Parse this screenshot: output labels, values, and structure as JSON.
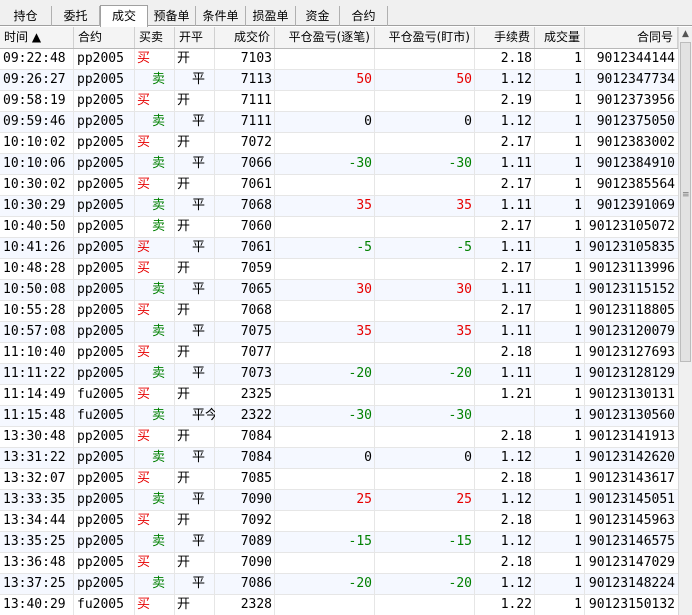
{
  "tabs": [
    {
      "label": "持仓",
      "active": false
    },
    {
      "label": "委托",
      "active": false
    },
    {
      "label": "成交",
      "active": true
    },
    {
      "label": "预备单",
      "active": false
    },
    {
      "label": "条件单",
      "active": false
    },
    {
      "label": "损盈单",
      "active": false
    },
    {
      "label": "资金",
      "active": false
    },
    {
      "label": "合约",
      "active": false
    }
  ],
  "columns": [
    "时间 ▲",
    "合约",
    "买卖",
    "开平",
    "成交价",
    "平仓盈亏(逐笔)",
    "平仓盈亏(盯市)",
    "手续费",
    "成交量",
    "合同号"
  ],
  "colors": {
    "buy": "#e60000",
    "sell": "#008000",
    "profit": "#e60000",
    "loss": "#008000"
  },
  "rows": [
    {
      "time": "09:22:48",
      "contract": "pp2005",
      "side": "买",
      "offset": "开",
      "price": "7103",
      "pnl_trade": "",
      "pnl_mark": "",
      "fee": "2.18",
      "qty": "1",
      "order_no": "9012344144"
    },
    {
      "time": "09:26:27",
      "contract": "pp2005",
      "side": "卖",
      "offset": "平",
      "price": "7113",
      "pnl_trade": "50",
      "pnl_mark": "50",
      "fee": "1.12",
      "qty": "1",
      "order_no": "9012347734"
    },
    {
      "time": "09:58:19",
      "contract": "pp2005",
      "side": "买",
      "offset": "开",
      "price": "7111",
      "pnl_trade": "",
      "pnl_mark": "",
      "fee": "2.19",
      "qty": "1",
      "order_no": "9012373956"
    },
    {
      "time": "09:59:46",
      "contract": "pp2005",
      "side": "卖",
      "offset": "平",
      "price": "7111",
      "pnl_trade": "0",
      "pnl_mark": "0",
      "fee": "1.12",
      "qty": "1",
      "order_no": "9012375050"
    },
    {
      "time": "10:10:02",
      "contract": "pp2005",
      "side": "买",
      "offset": "开",
      "price": "7072",
      "pnl_trade": "",
      "pnl_mark": "",
      "fee": "2.17",
      "qty": "1",
      "order_no": "9012383002"
    },
    {
      "time": "10:10:06",
      "contract": "pp2005",
      "side": "卖",
      "offset": "平",
      "price": "7066",
      "pnl_trade": "-30",
      "pnl_mark": "-30",
      "fee": "1.11",
      "qty": "1",
      "order_no": "9012384910"
    },
    {
      "time": "10:30:02",
      "contract": "pp2005",
      "side": "买",
      "offset": "开",
      "price": "7061",
      "pnl_trade": "",
      "pnl_mark": "",
      "fee": "2.17",
      "qty": "1",
      "order_no": "9012385564"
    },
    {
      "time": "10:30:29",
      "contract": "pp2005",
      "side": "卖",
      "offset": "平",
      "price": "7068",
      "pnl_trade": "35",
      "pnl_mark": "35",
      "fee": "1.11",
      "qty": "1",
      "order_no": "9012391069"
    },
    {
      "time": "10:40:50",
      "contract": "pp2005",
      "side": "卖",
      "offset": "开",
      "price": "7060",
      "pnl_trade": "",
      "pnl_mark": "",
      "fee": "2.17",
      "qty": "1",
      "order_no": "90123105072"
    },
    {
      "time": "10:41:26",
      "contract": "pp2005",
      "side": "买",
      "offset": "平",
      "price": "7061",
      "pnl_trade": "-5",
      "pnl_mark": "-5",
      "fee": "1.11",
      "qty": "1",
      "order_no": "90123105835"
    },
    {
      "time": "10:48:28",
      "contract": "pp2005",
      "side": "买",
      "offset": "开",
      "price": "7059",
      "pnl_trade": "",
      "pnl_mark": "",
      "fee": "2.17",
      "qty": "1",
      "order_no": "90123113996"
    },
    {
      "time": "10:50:08",
      "contract": "pp2005",
      "side": "卖",
      "offset": "平",
      "price": "7065",
      "pnl_trade": "30",
      "pnl_mark": "30",
      "fee": "1.11",
      "qty": "1",
      "order_no": "90123115152"
    },
    {
      "time": "10:55:28",
      "contract": "pp2005",
      "side": "买",
      "offset": "开",
      "price": "7068",
      "pnl_trade": "",
      "pnl_mark": "",
      "fee": "2.17",
      "qty": "1",
      "order_no": "90123118805"
    },
    {
      "time": "10:57:08",
      "contract": "pp2005",
      "side": "卖",
      "offset": "平",
      "price": "7075",
      "pnl_trade": "35",
      "pnl_mark": "35",
      "fee": "1.11",
      "qty": "1",
      "order_no": "90123120079"
    },
    {
      "time": "11:10:40",
      "contract": "pp2005",
      "side": "买",
      "offset": "开",
      "price": "7077",
      "pnl_trade": "",
      "pnl_mark": "",
      "fee": "2.18",
      "qty": "1",
      "order_no": "90123127693"
    },
    {
      "time": "11:11:22",
      "contract": "pp2005",
      "side": "卖",
      "offset": "平",
      "price": "7073",
      "pnl_trade": "-20",
      "pnl_mark": "-20",
      "fee": "1.11",
      "qty": "1",
      "order_no": "90123128129"
    },
    {
      "time": "11:14:49",
      "contract": "fu2005",
      "side": "买",
      "offset": "开",
      "price": "2325",
      "pnl_trade": "",
      "pnl_mark": "",
      "fee": "1.21",
      "qty": "1",
      "order_no": "90123130131"
    },
    {
      "time": "11:15:48",
      "contract": "fu2005",
      "side": "卖",
      "offset": "平今",
      "price": "2322",
      "pnl_trade": "-30",
      "pnl_mark": "-30",
      "fee": "",
      "qty": "1",
      "order_no": "90123130560"
    },
    {
      "time": "13:30:48",
      "contract": "pp2005",
      "side": "买",
      "offset": "开",
      "price": "7084",
      "pnl_trade": "",
      "pnl_mark": "",
      "fee": "2.18",
      "qty": "1",
      "order_no": "90123141913"
    },
    {
      "time": "13:31:22",
      "contract": "pp2005",
      "side": "卖",
      "offset": "平",
      "price": "7084",
      "pnl_trade": "0",
      "pnl_mark": "0",
      "fee": "1.12",
      "qty": "1",
      "order_no": "90123142620"
    },
    {
      "time": "13:32:07",
      "contract": "pp2005",
      "side": "买",
      "offset": "开",
      "price": "7085",
      "pnl_trade": "",
      "pnl_mark": "",
      "fee": "2.18",
      "qty": "1",
      "order_no": "90123143617"
    },
    {
      "time": "13:33:35",
      "contract": "pp2005",
      "side": "卖",
      "offset": "平",
      "price": "7090",
      "pnl_trade": "25",
      "pnl_mark": "25",
      "fee": "1.12",
      "qty": "1",
      "order_no": "90123145051"
    },
    {
      "time": "13:34:44",
      "contract": "pp2005",
      "side": "买",
      "offset": "开",
      "price": "7092",
      "pnl_trade": "",
      "pnl_mark": "",
      "fee": "2.18",
      "qty": "1",
      "order_no": "90123145963"
    },
    {
      "time": "13:35:25",
      "contract": "pp2005",
      "side": "卖",
      "offset": "平",
      "price": "7089",
      "pnl_trade": "-15",
      "pnl_mark": "-15",
      "fee": "1.12",
      "qty": "1",
      "order_no": "90123146575"
    },
    {
      "time": "13:36:48",
      "contract": "pp2005",
      "side": "买",
      "offset": "开",
      "price": "7090",
      "pnl_trade": "",
      "pnl_mark": "",
      "fee": "2.18",
      "qty": "1",
      "order_no": "90123147029"
    },
    {
      "time": "13:37:25",
      "contract": "pp2005",
      "side": "卖",
      "offset": "平",
      "price": "7086",
      "pnl_trade": "-20",
      "pnl_mark": "-20",
      "fee": "1.12",
      "qty": "1",
      "order_no": "90123148224"
    },
    {
      "time": "13:40:29",
      "contract": "fu2005",
      "side": "买",
      "offset": "开",
      "price": "2328",
      "pnl_trade": "",
      "pnl_mark": "",
      "fee": "1.22",
      "qty": "1",
      "order_no": "90123150132"
    }
  ]
}
